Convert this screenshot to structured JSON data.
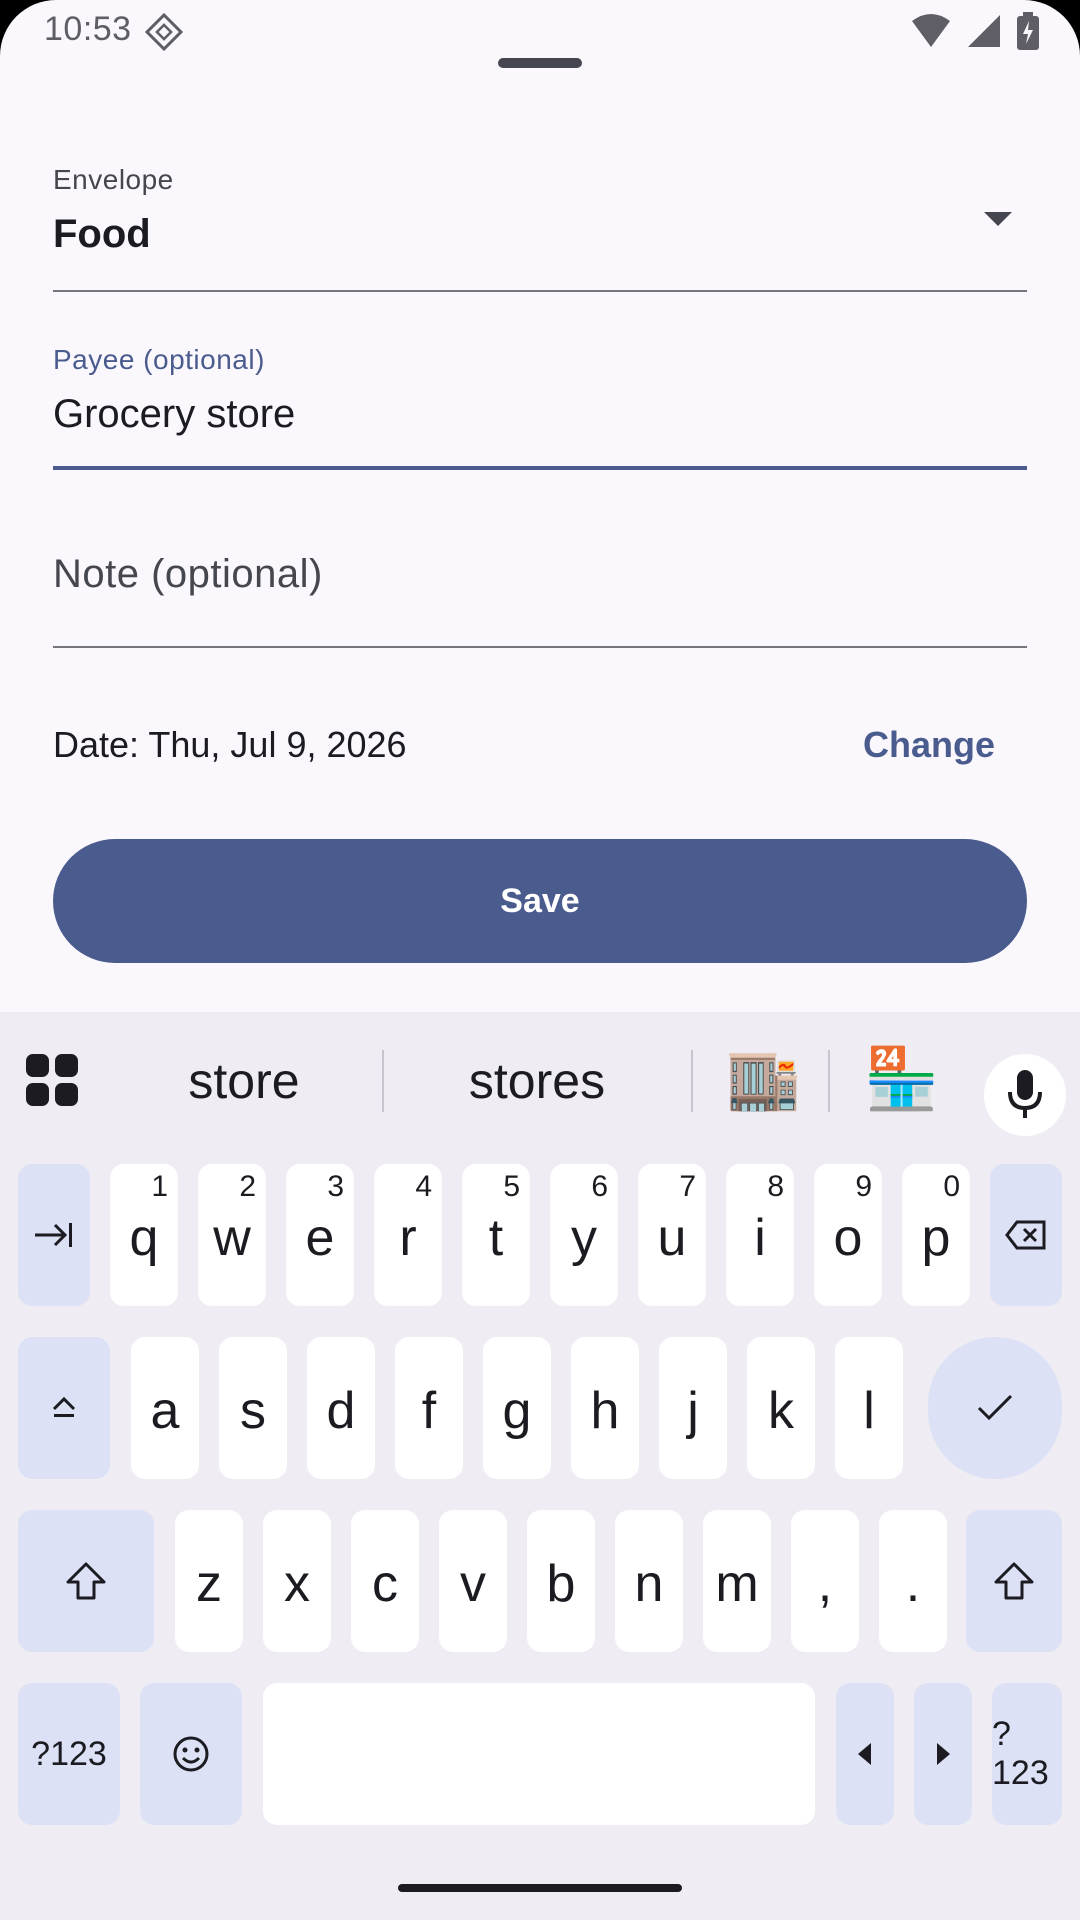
{
  "status_bar": {
    "time": "10:53"
  },
  "form": {
    "envelope": {
      "label": "Envelope",
      "value": "Food"
    },
    "payee": {
      "label": "Payee (optional)",
      "value": "Grocery store"
    },
    "note": {
      "placeholder": "Note (optional)"
    },
    "date": {
      "text": "Date: Thu, Jul 9, 2026",
      "change_label": "Change"
    },
    "save_label": "Save"
  },
  "keyboard": {
    "suggestions": [
      "store",
      "stores"
    ],
    "emoji_suggestions": [
      "🏬",
      "🏪"
    ],
    "row1": [
      {
        "letter": "q",
        "hint": "1"
      },
      {
        "letter": "w",
        "hint": "2"
      },
      {
        "letter": "e",
        "hint": "3"
      },
      {
        "letter": "r",
        "hint": "4"
      },
      {
        "letter": "t",
        "hint": "5"
      },
      {
        "letter": "y",
        "hint": "6"
      },
      {
        "letter": "u",
        "hint": "7"
      },
      {
        "letter": "i",
        "hint": "8"
      },
      {
        "letter": "o",
        "hint": "9"
      },
      {
        "letter": "p",
        "hint": "0"
      }
    ],
    "row2": [
      "a",
      "s",
      "d",
      "f",
      "g",
      "h",
      "j",
      "k",
      "l"
    ],
    "row3": [
      "z",
      "x",
      "c",
      "v",
      "b",
      "n",
      "m",
      ",",
      "."
    ],
    "symbols_label": "?123"
  },
  "colors": {
    "primary": "#4a5b8e",
    "surface": "#fbf8fd",
    "keyboard_bg": "#efedf3",
    "mod_key": "#dde1f5"
  }
}
